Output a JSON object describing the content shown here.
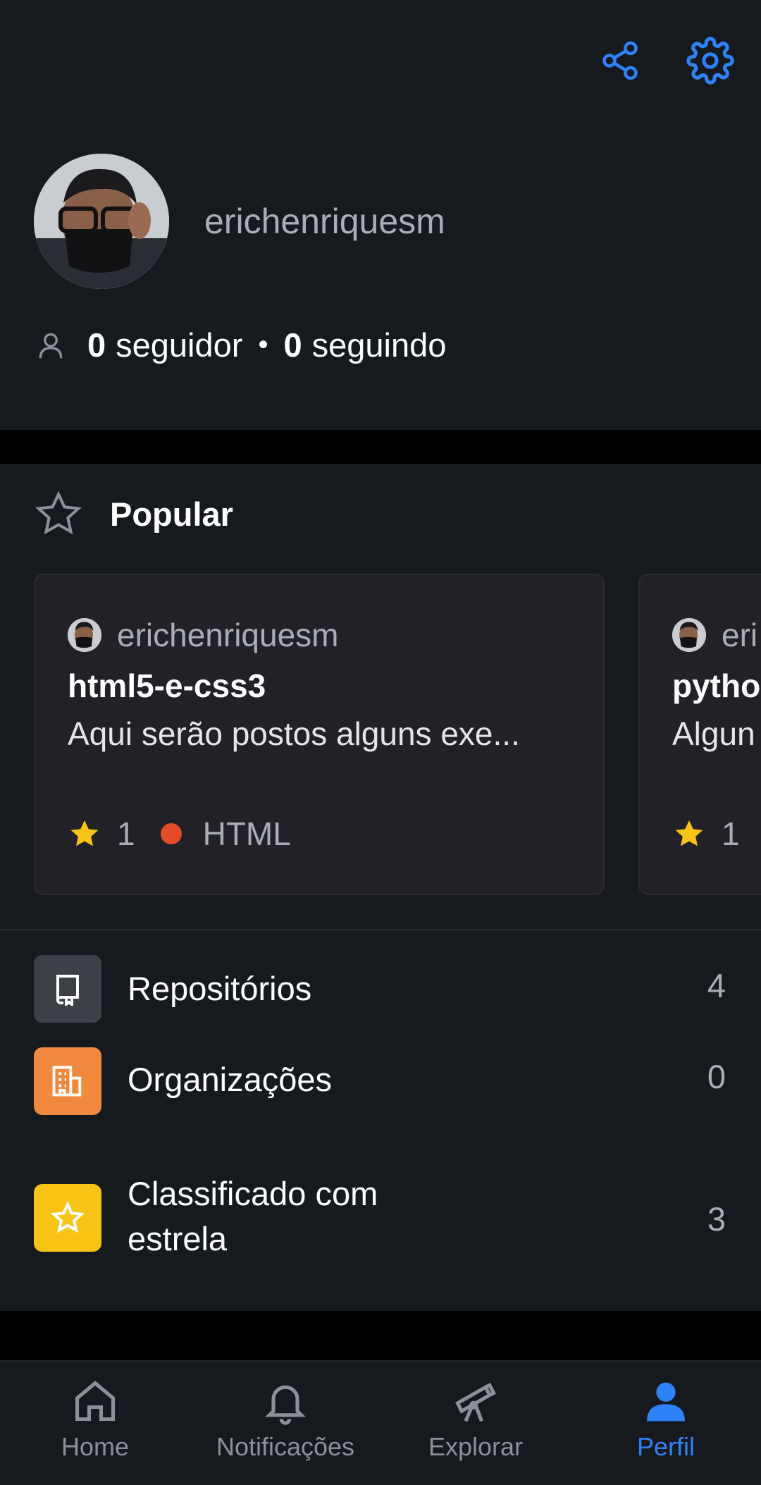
{
  "profile": {
    "username": "erichenriquesm",
    "followers_count": "0",
    "followers_label": "seguidor",
    "separator": "•",
    "following_count": "0",
    "following_label": "seguindo",
    "actions": [
      "share-icon",
      "gear-icon"
    ]
  },
  "popular": {
    "title": "Popular",
    "cards": [
      {
        "owner": "erichenriquesm",
        "name": "html5-e-css3",
        "description": "Aqui serão postos alguns exe...",
        "stars": "1",
        "language": "HTML",
        "language_color": "#e34c26"
      },
      {
        "owner": "eri",
        "name": "pytho",
        "description": "Algun",
        "stars": "1"
      }
    ]
  },
  "menu": [
    {
      "label": "Repositórios",
      "count": "4",
      "icon": "repo-icon",
      "tile_color": "#3d4046"
    },
    {
      "label": "Organizações",
      "count": "0",
      "icon": "organization-icon",
      "tile_color": "#f0883e"
    },
    {
      "label": "Classificado com estrela",
      "count": "3",
      "icon": "star-icon",
      "tile_color": "#f7c416"
    }
  ],
  "nav": [
    {
      "label": "Home",
      "icon": "home-icon",
      "active": false
    },
    {
      "label": "Notificações",
      "icon": "bell-icon",
      "active": false
    },
    {
      "label": "Explorar",
      "icon": "telescope-icon",
      "active": false
    },
    {
      "label": "Perfil",
      "icon": "person-icon",
      "active": true
    }
  ],
  "colors": {
    "accent": "#2f81f7",
    "background": "#161a1f",
    "card": "#222127",
    "star": "#f7c416"
  }
}
